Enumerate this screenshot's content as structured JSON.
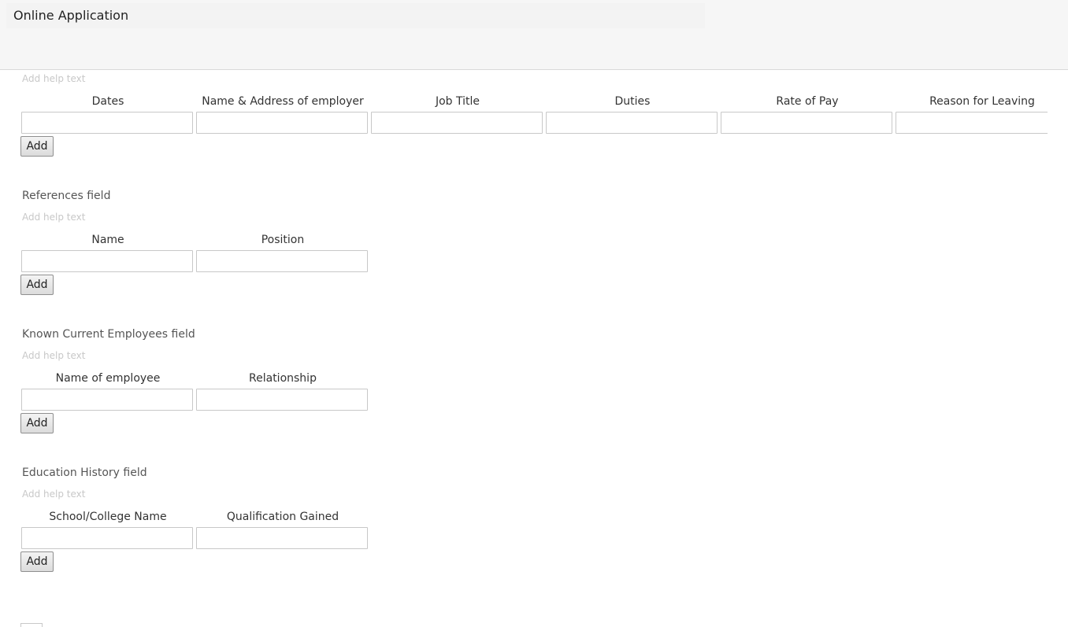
{
  "header": {
    "title": "Online Application"
  },
  "employment_section": {
    "help_text": "Add help text",
    "columns": [
      "Dates",
      "Name & Address of employer",
      "Job Title",
      "Duties",
      "Rate of Pay",
      "Reason for Leaving"
    ],
    "add_label": "Add"
  },
  "references_section": {
    "title": "References field",
    "help_text": "Add help text",
    "columns": [
      "Name",
      "Position"
    ],
    "add_label": "Add"
  },
  "employees_section": {
    "title": "Known Current Employees field",
    "help_text": "Add help text",
    "columns": [
      "Name of employee",
      "Relationship"
    ],
    "add_label": "Add"
  },
  "education_section": {
    "title": "Education History field",
    "help_text": "Add help text",
    "columns": [
      "School/College Name",
      "Qualification Gained"
    ],
    "add_label": "Add"
  }
}
